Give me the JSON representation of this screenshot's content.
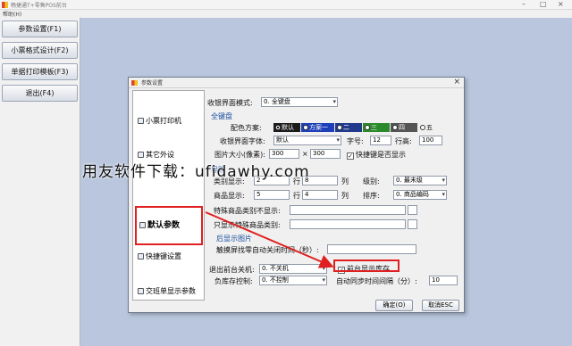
{
  "app": {
    "title": "畅捷通T+零售POS前台",
    "menu": "帮助(H)"
  },
  "left_buttons": [
    "参数设置(F1)",
    "小票格式设计(F2)",
    "单据打印模板(F3)",
    "退出(F4)"
  ],
  "dialog": {
    "title": "参数设置",
    "close": "×",
    "side_items": [
      "小票打印机",
      "其它外设",
      "默认参数",
      "快捷键设置",
      "交班单显示参数"
    ],
    "selected": "默认参数",
    "cashier_mode_label": "收银界面模式:",
    "cashier_mode_value": "0. 全键盘",
    "section_full_keyboard": "全键盘",
    "color_scheme_label": "配色方案:",
    "schemes": [
      {
        "label": "默认",
        "color": "#1b1b1b",
        "checked": true
      },
      {
        "label": "方案一",
        "color": "#1d3fb8",
        "checked": false
      },
      {
        "label": "二",
        "color": "#213a8c",
        "checked": false
      },
      {
        "label": "三",
        "color": "#2c8a2c",
        "checked": false
      },
      {
        "label": "四",
        "color": "#555555",
        "checked": false
      },
      {
        "label": "五",
        "color": "#f0f0f0",
        "checked": false
      }
    ],
    "font_label": "收银界面字体:",
    "font_value": "默认",
    "font_size_label": "字号:",
    "font_size_value": "12",
    "row_height_label": "行高:",
    "row_height_value": "100",
    "image_size_label": "图片大小(像素):",
    "image_w": "300",
    "image_x": "×",
    "image_h": "300",
    "shortcut_check_label": "快捷键是否显示",
    "shortcut_checked": true,
    "section_shopping_guide": "导购",
    "category_display_label": "类别显示:",
    "category_rows": "2",
    "row_unit": "行",
    "category_cols": "8",
    "col_unit": "列",
    "level_label": "级别:",
    "level_value": "0. 最末级",
    "goods_display_label": "商品显示:",
    "goods_rows": "5",
    "goods_cols": "4",
    "sort_label": "排序:",
    "sort_value": "0. 商品编码",
    "special_not_show_label": "特殊商品类别不显示:",
    "only_show_special_label": "只显示特殊商品类别:",
    "section_background": "后显示图片",
    "touch_close_label": "触摸屏找零自动关闭时间（秒）:",
    "exit_close_label": "退出前台关机:",
    "exit_close_value": "0. 不关机",
    "show_stock_label": "前台显示库存",
    "show_stock_checked": true,
    "negative_stock_label": "负库存控制:",
    "negative_stock_value": "0. 不控制",
    "auto_sync_label": "自动同步时间间隔（分）:",
    "auto_sync_value": "10",
    "ok_button": "确定(O)",
    "cancel_button": "取消ESC"
  },
  "watermark": "用友软件下载：ufidawhy.com",
  "colors": {
    "highlight": "#e02020",
    "desktop": "#b9c6dd"
  }
}
